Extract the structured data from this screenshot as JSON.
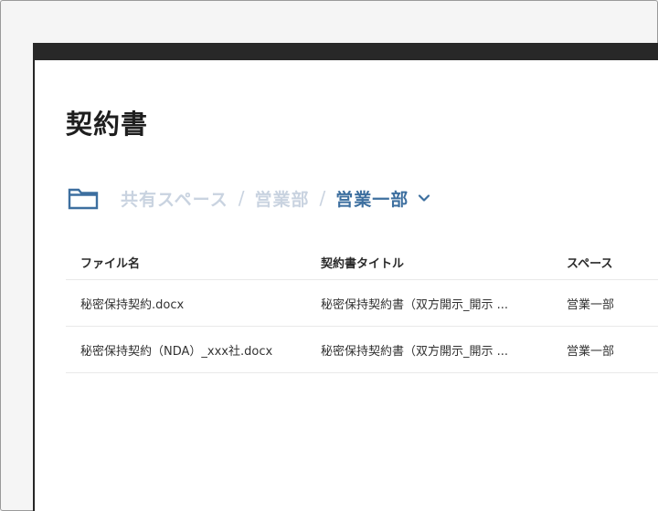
{
  "page": {
    "title": "契約書"
  },
  "breadcrumb": {
    "items": [
      "共有スペース",
      "営業部"
    ],
    "separator": "/",
    "current": "営業一部"
  },
  "table": {
    "columns": [
      "ファイル名",
      "契約書タイトル",
      "スペース"
    ],
    "rows": [
      {
        "file_name": "秘密保持契約.docx",
        "contract_title": "秘密保持契約書（双方開示_開示 ...",
        "space": "営業一部"
      },
      {
        "file_name": "秘密保持契約（NDA）_xxx社.docx",
        "contract_title": "秘密保持契約書（双方開示_開示 ...",
        "space": "営業一部"
      }
    ]
  },
  "colors": {
    "accent": "#3d6f9f",
    "breadcrumb_inactive": "#c9d3e0",
    "topbar": "#282828"
  },
  "icons": {
    "folder": "folder-icon",
    "chevron": "chevron-down-icon"
  }
}
